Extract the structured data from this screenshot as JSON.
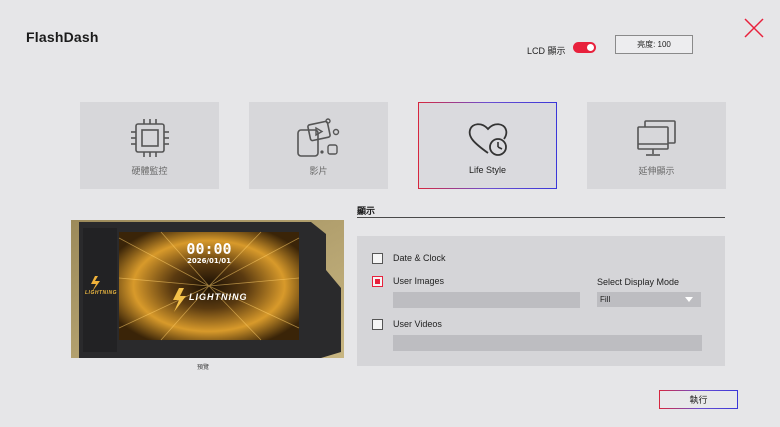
{
  "app": {
    "title": "FlashDash"
  },
  "header": {
    "lcd_label": "LCD 顯示",
    "lcd_on": true,
    "brightness_label": "亮度: 100"
  },
  "tiles": [
    {
      "label": "硬體監控",
      "icon": "chip-icon"
    },
    {
      "label": "影片",
      "icon": "media-icon"
    },
    {
      "label": "Life Style",
      "icon": "heart-clock-icon",
      "active": true
    },
    {
      "label": "延伸顯示",
      "icon": "monitors-icon"
    }
  ],
  "display": {
    "section_title": "顯示",
    "options": {
      "date_clock": {
        "label": "Date & Clock",
        "checked": false
      },
      "user_images": {
        "label": "User Images",
        "checked": true
      },
      "user_videos": {
        "label": "User Videos",
        "checked": false
      }
    },
    "display_mode_label": "Select Display Mode",
    "display_mode_value": "Fill"
  },
  "preview": {
    "time": "00:00",
    "date": "2026/01/01",
    "brand": "LIGHTNING",
    "caption": "預覽"
  },
  "actions": {
    "execute_label": "執行"
  },
  "colors": {
    "accent": "#e8213c",
    "active_border_start": "#d7263d",
    "active_border_end": "#3a36d8"
  }
}
